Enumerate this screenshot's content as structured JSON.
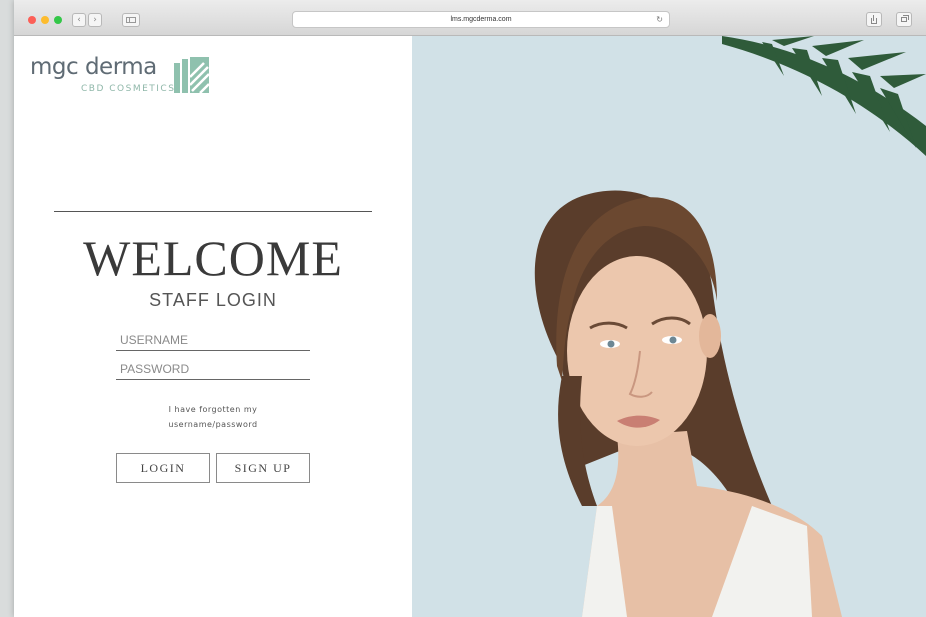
{
  "browser": {
    "url": "lms.mgcderma.com",
    "back_glyph": "‹",
    "forward_glyph": "›",
    "reload_glyph": "↻"
  },
  "brand": {
    "name": "mgc derma",
    "tagline": "CBD COSMETICS",
    "logo_color": "#8fc1ae",
    "text_color": "#5f6b74"
  },
  "login": {
    "heading": "WELCOME",
    "subheading": "STAFF LOGIN",
    "username_placeholder": "USERNAME",
    "password_placeholder": "PASSWORD",
    "forgot_line1": "I have forgotten my",
    "forgot_line2": "username/password",
    "login_label": "LOGIN",
    "signup_label": "SIGN UP"
  },
  "hero": {
    "background_color": "#d1e1e7"
  }
}
